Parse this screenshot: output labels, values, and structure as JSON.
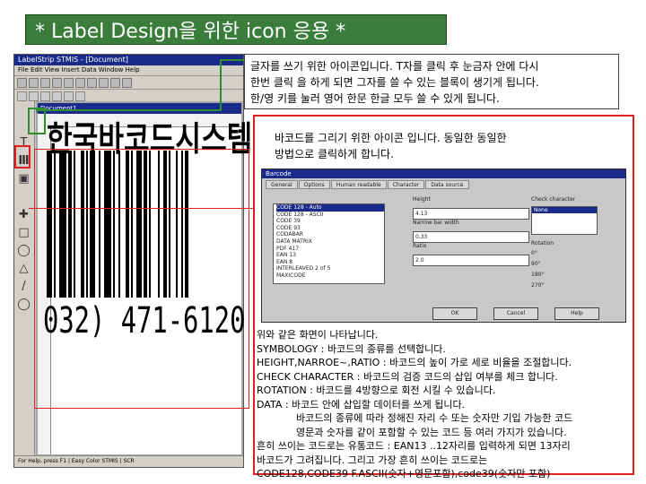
{
  "slide_title": "* Label Design을 위한 icon 응용 *",
  "app": {
    "window_title": "LabelStrip STMIS - [Document]",
    "menu": "File  Edit  View  Insert  Data  Window  Help",
    "doc_title": "Document1",
    "statusbar": "For Help, press F1  |  Easy Color STMIS  |  SCR"
  },
  "tools": [
    "T",
    "Ⅲ",
    "▣",
    "✚",
    "□",
    "◯",
    "△",
    "/",
    "◯"
  ],
  "label_text": "한국바코드시스템",
  "phone_text": "032) 471-6120",
  "callout_text": {
    "line1": "글자를 쓰기 위한 아이콘입니다. T자를 클릭 후 눈금자 안에 다시",
    "line2": "한번 클릭 을 하게 되면 그자를 쓸 수 있는 블록이 생기게 됩니다.",
    "line3": "한/영 키를 눌러 영어 한문 한글 모두 쓸 수 있게 됩니다."
  },
  "callout_barcode": {
    "line1": "바코드를 그리기 위한 아이콘 입니다. 동일한 동일한",
    "line2": "방법으로 클릭하게 합니다."
  },
  "dialog": {
    "title": "Barcode",
    "tabs": [
      "General",
      "Options",
      "Human readable",
      "Character",
      "Data source"
    ],
    "symbology_items": [
      "CODE 128 - Auto",
      "CODE 128 - ASCII",
      "CODE 39",
      "CODE 93",
      "CODABAR",
      "DATA MATRIX",
      "PDF 417",
      "EAN 13",
      "EAN 8",
      "INTERLEAVED 2 of 5",
      "MAXICODE"
    ],
    "height_label": "Height",
    "height_value": "4.13",
    "narrow_label": "Narrow bar width",
    "narrow_value": "0.33",
    "ratio_label": "Ratio",
    "ratio_value": "2.0",
    "check_label": "Check character",
    "check_value": "None",
    "rotation_label": "Rotation",
    "rotation_options": [
      "0°",
      "90°",
      "180°",
      "270°"
    ],
    "ok": "OK",
    "cancel": "Cancel",
    "help": "Help"
  },
  "explanation": {
    "l1": "위와 같은 화면이 나타납니다.",
    "l2": "SYMBOLOGY : 바코드의 종류를 선택합니다.",
    "l3": "HEIGHT,NARROE~,RATIO : 바코드의 높이 가로 세로 비율을 조절합니다.",
    "l4": "CHECK CHARACTER : 바코드의 검증 코드의 삽입 여부를 체크 합니다.",
    "l5": "ROTATION : 바코드를 4방향으로 회전 시킬 수 있습니다.",
    "l6": "DATA : 바코드 안에 삽입할 데이터를 쓰게 됩니다.",
    "l7": "바코드의 종류에 따라 정해진 자리 수 또는 숫자만 기입 가능한 코드",
    "l8": "영문과 숫자를 같이 포함할 수 있는 코드 등 여러 가지가 있습니다.",
    "l9": "흔히 쓰이는 코드로는 유통코드 : EAN13 ..12자리를 입력하게 되면 13자리",
    "l10": "바코드가 그려집니다. 그리고 가장 흔히 쓰이는 코드로는",
    "l11": "CODE128,CODE39 F.ASCII(숫자+영문포함),code39(숫자만 포함)"
  },
  "colors": {
    "title_bg": "#3a7d3a",
    "highlight_green": "#2f8f2f",
    "highlight_red": "#e02020",
    "window_blue": "#1a2a8a"
  }
}
